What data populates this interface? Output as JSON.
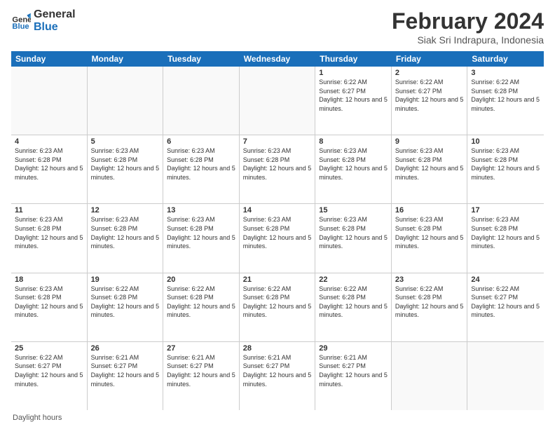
{
  "logo": {
    "line1": "General",
    "line2": "Blue"
  },
  "title": "February 2024",
  "subtitle": "Siak Sri Indrapura, Indonesia",
  "days": [
    "Sunday",
    "Monday",
    "Tuesday",
    "Wednesday",
    "Thursday",
    "Friday",
    "Saturday"
  ],
  "weeks": [
    [
      {
        "day": "",
        "info": ""
      },
      {
        "day": "",
        "info": ""
      },
      {
        "day": "",
        "info": ""
      },
      {
        "day": "",
        "info": ""
      },
      {
        "day": "1",
        "info": "Sunrise: 6:22 AM\nSunset: 6:27 PM\nDaylight: 12 hours and 5 minutes."
      },
      {
        "day": "2",
        "info": "Sunrise: 6:22 AM\nSunset: 6:27 PM\nDaylight: 12 hours and 5 minutes."
      },
      {
        "day": "3",
        "info": "Sunrise: 6:22 AM\nSunset: 6:28 PM\nDaylight: 12 hours and 5 minutes."
      }
    ],
    [
      {
        "day": "4",
        "info": "Sunrise: 6:23 AM\nSunset: 6:28 PM\nDaylight: 12 hours and 5 minutes."
      },
      {
        "day": "5",
        "info": "Sunrise: 6:23 AM\nSunset: 6:28 PM\nDaylight: 12 hours and 5 minutes."
      },
      {
        "day": "6",
        "info": "Sunrise: 6:23 AM\nSunset: 6:28 PM\nDaylight: 12 hours and 5 minutes."
      },
      {
        "day": "7",
        "info": "Sunrise: 6:23 AM\nSunset: 6:28 PM\nDaylight: 12 hours and 5 minutes."
      },
      {
        "day": "8",
        "info": "Sunrise: 6:23 AM\nSunset: 6:28 PM\nDaylight: 12 hours and 5 minutes."
      },
      {
        "day": "9",
        "info": "Sunrise: 6:23 AM\nSunset: 6:28 PM\nDaylight: 12 hours and 5 minutes."
      },
      {
        "day": "10",
        "info": "Sunrise: 6:23 AM\nSunset: 6:28 PM\nDaylight: 12 hours and 5 minutes."
      }
    ],
    [
      {
        "day": "11",
        "info": "Sunrise: 6:23 AM\nSunset: 6:28 PM\nDaylight: 12 hours and 5 minutes."
      },
      {
        "day": "12",
        "info": "Sunrise: 6:23 AM\nSunset: 6:28 PM\nDaylight: 12 hours and 5 minutes."
      },
      {
        "day": "13",
        "info": "Sunrise: 6:23 AM\nSunset: 6:28 PM\nDaylight: 12 hours and 5 minutes."
      },
      {
        "day": "14",
        "info": "Sunrise: 6:23 AM\nSunset: 6:28 PM\nDaylight: 12 hours and 5 minutes."
      },
      {
        "day": "15",
        "info": "Sunrise: 6:23 AM\nSunset: 6:28 PM\nDaylight: 12 hours and 5 minutes."
      },
      {
        "day": "16",
        "info": "Sunrise: 6:23 AM\nSunset: 6:28 PM\nDaylight: 12 hours and 5 minutes."
      },
      {
        "day": "17",
        "info": "Sunrise: 6:23 AM\nSunset: 6:28 PM\nDaylight: 12 hours and 5 minutes."
      }
    ],
    [
      {
        "day": "18",
        "info": "Sunrise: 6:23 AM\nSunset: 6:28 PM\nDaylight: 12 hours and 5 minutes."
      },
      {
        "day": "19",
        "info": "Sunrise: 6:22 AM\nSunset: 6:28 PM\nDaylight: 12 hours and 5 minutes."
      },
      {
        "day": "20",
        "info": "Sunrise: 6:22 AM\nSunset: 6:28 PM\nDaylight: 12 hours and 5 minutes."
      },
      {
        "day": "21",
        "info": "Sunrise: 6:22 AM\nSunset: 6:28 PM\nDaylight: 12 hours and 5 minutes."
      },
      {
        "day": "22",
        "info": "Sunrise: 6:22 AM\nSunset: 6:28 PM\nDaylight: 12 hours and 5 minutes."
      },
      {
        "day": "23",
        "info": "Sunrise: 6:22 AM\nSunset: 6:28 PM\nDaylight: 12 hours and 5 minutes."
      },
      {
        "day": "24",
        "info": "Sunrise: 6:22 AM\nSunset: 6:27 PM\nDaylight: 12 hours and 5 minutes."
      }
    ],
    [
      {
        "day": "25",
        "info": "Sunrise: 6:22 AM\nSunset: 6:27 PM\nDaylight: 12 hours and 5 minutes."
      },
      {
        "day": "26",
        "info": "Sunrise: 6:21 AM\nSunset: 6:27 PM\nDaylight: 12 hours and 5 minutes."
      },
      {
        "day": "27",
        "info": "Sunrise: 6:21 AM\nSunset: 6:27 PM\nDaylight: 12 hours and 5 minutes."
      },
      {
        "day": "28",
        "info": "Sunrise: 6:21 AM\nSunset: 6:27 PM\nDaylight: 12 hours and 5 minutes."
      },
      {
        "day": "29",
        "info": "Sunrise: 6:21 AM\nSunset: 6:27 PM\nDaylight: 12 hours and 5 minutes."
      },
      {
        "day": "",
        "info": ""
      },
      {
        "day": "",
        "info": ""
      }
    ]
  ],
  "footer": "Daylight hours"
}
